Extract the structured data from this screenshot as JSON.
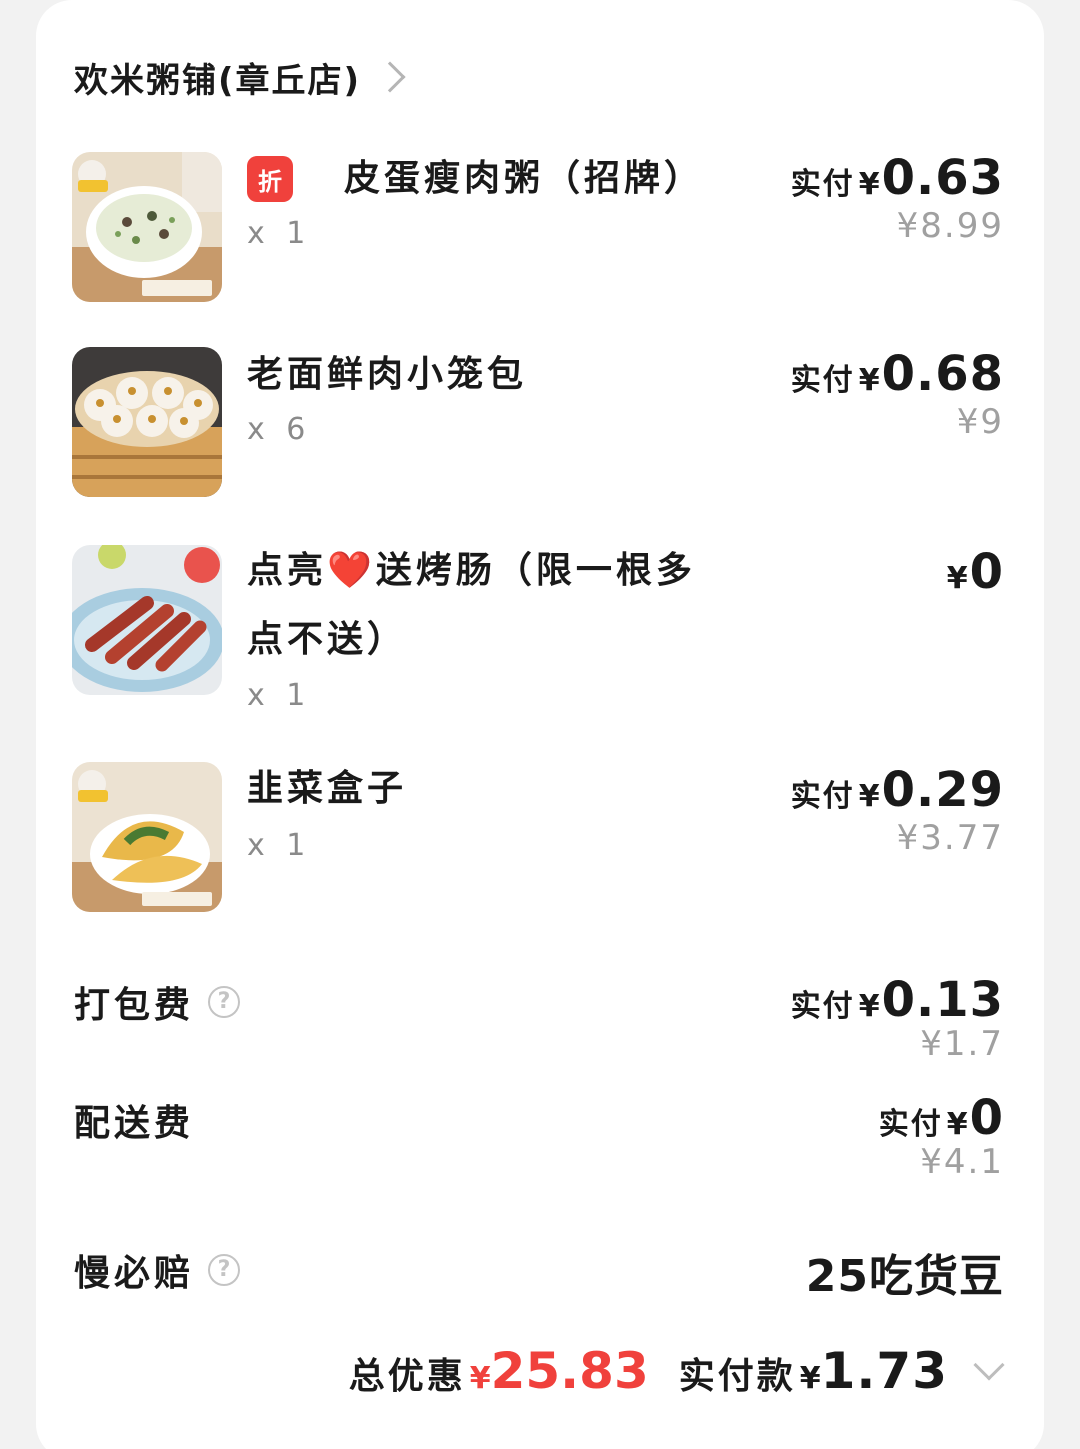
{
  "store": {
    "name": "欢米粥铺(章丘店)"
  },
  "items": [
    {
      "badge": "折",
      "name": "皮蛋瘦肉粥（招牌）",
      "qty": "x 1",
      "paid_label": "实付",
      "currency": "¥",
      "paid": "0.63",
      "original": "¥8.99",
      "image": "porridge-photo"
    },
    {
      "name": "老面鲜肉小笼包",
      "qty": "x 6",
      "paid_label": "实付",
      "currency": "¥",
      "paid": "0.68",
      "original": "¥9",
      "image": "steamed-buns-photo"
    },
    {
      "name_line1_prefix": "点亮",
      "name_heart": "❤️",
      "name_line1_suffix": "送烤肠（限一根多",
      "name_line2": "点不送）",
      "qty": "x 1",
      "currency": "¥",
      "paid": "0",
      "image": "sausage-photo"
    },
    {
      "name": "韭菜盒子",
      "qty": "x 1",
      "paid_label": "实付",
      "currency": "¥",
      "paid": "0.29",
      "original": "¥3.77",
      "image": "chive-pie-photo"
    }
  ],
  "fees": {
    "packing": {
      "label": "打包费",
      "help": "?",
      "paid_label": "实付",
      "currency": "¥",
      "paid": "0.13",
      "original": "¥1.7"
    },
    "delivery": {
      "label": "配送费",
      "paid_label": "实付",
      "currency": "¥",
      "paid": "0",
      "original": "¥4.1"
    },
    "late_comp": {
      "label": "慢必赔",
      "help": "?",
      "value": "25吃货豆"
    }
  },
  "footer": {
    "discount_label": "总优惠",
    "discount_currency": "¥",
    "discount_amount": "25.83",
    "pay_label": "实付款",
    "pay_currency": "¥",
    "pay_amount": "1.73"
  },
  "colors": {
    "accent_red": "#f0413c",
    "text": "#1a1a1a",
    "muted": "#a0a0a0"
  }
}
